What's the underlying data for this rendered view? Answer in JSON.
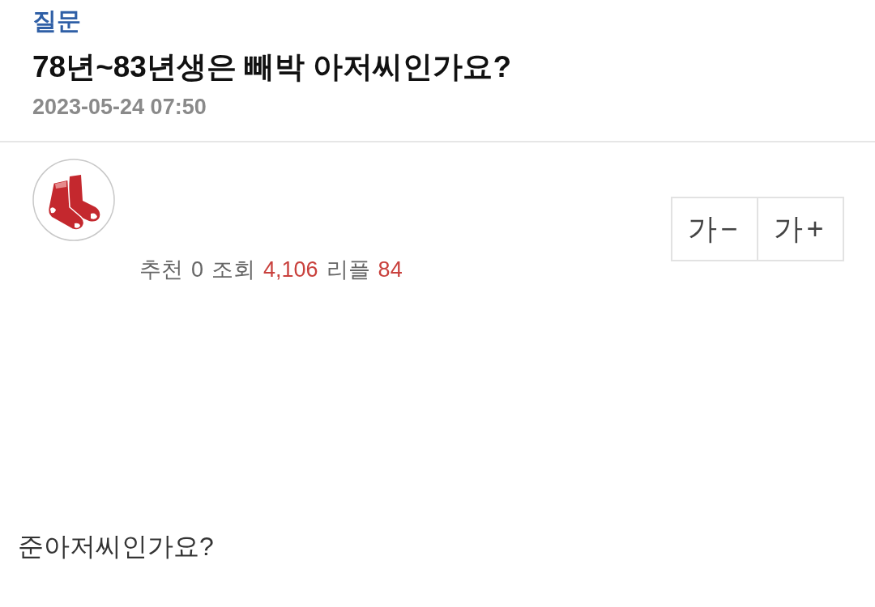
{
  "post": {
    "category": "질문",
    "title": "78년~83년생은 빼박 아저씨인가요?",
    "date": "2023-05-24 07:50"
  },
  "stats": [
    {
      "label": "추천",
      "value": "0",
      "highlighted": false
    },
    {
      "label": "조회",
      "value": "4,106",
      "highlighted": true
    },
    {
      "label": "리플",
      "value": "84",
      "highlighted": true
    }
  ],
  "font_size_buttons": [
    "가−",
    "가+"
  ],
  "body": "준아저씨인가요?"
}
